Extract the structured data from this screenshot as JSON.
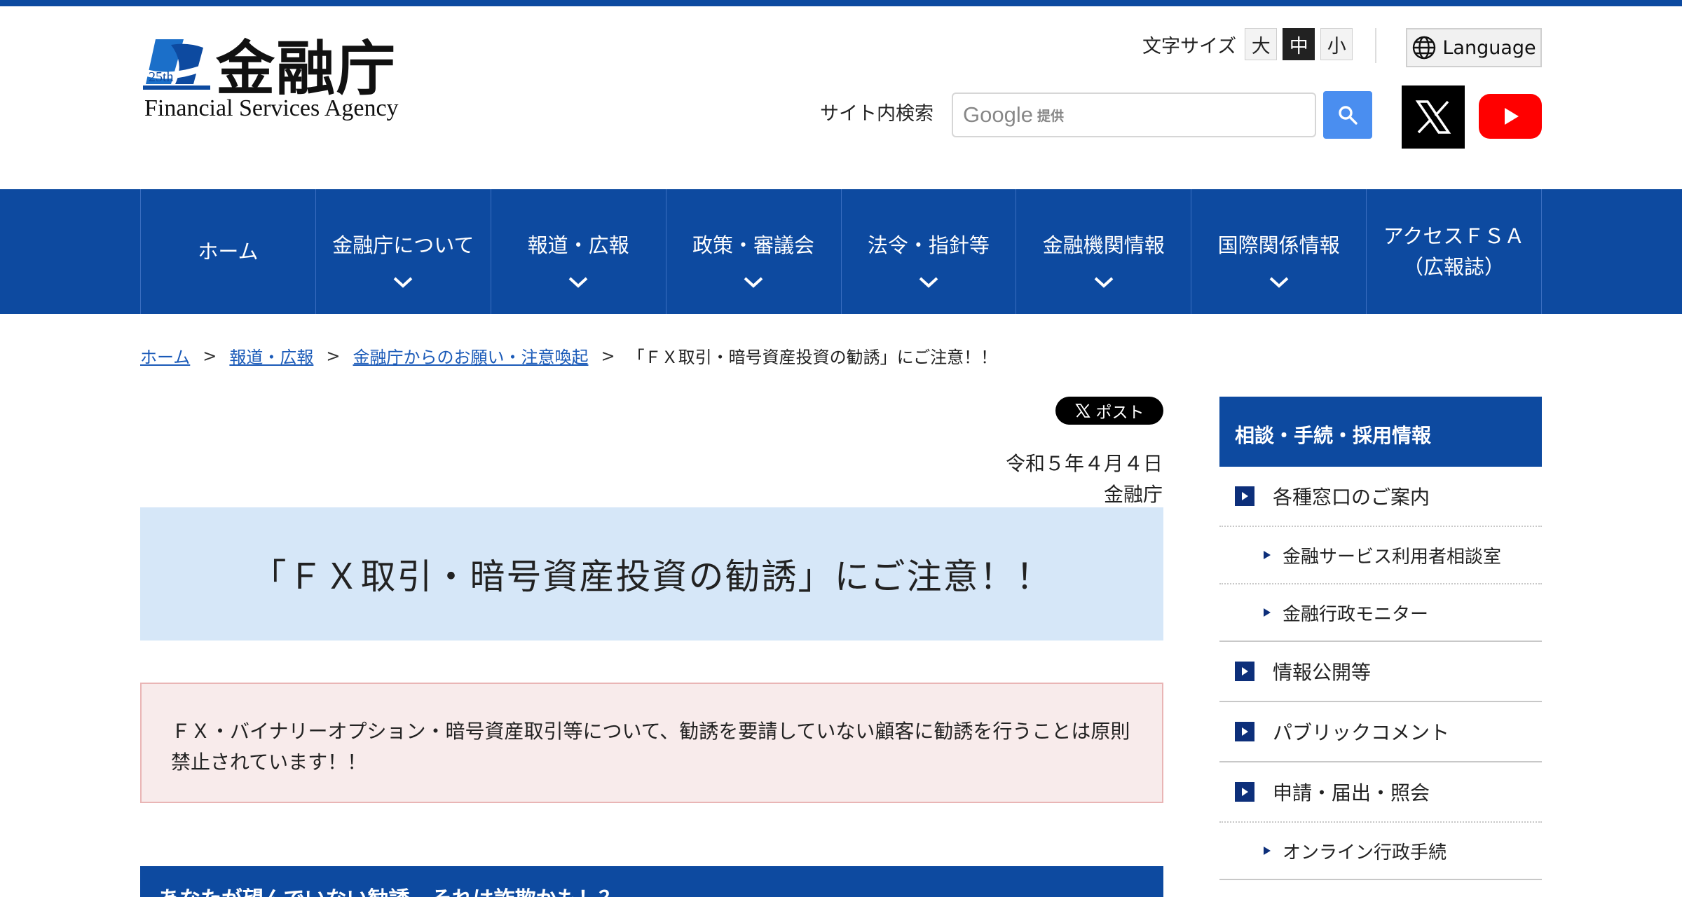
{
  "header": {
    "logo_ja": "金融庁",
    "logo_en": "Financial Services Agency",
    "logo_badge": "25th",
    "font_size_label": "文字サイズ",
    "font_sizes": [
      "大",
      "中",
      "小"
    ],
    "active_font_size": "中",
    "language_label": "Language",
    "search_label": "サイト内検索",
    "search_brand": "Google",
    "search_brand_sub": "提供"
  },
  "nav": {
    "items": [
      {
        "label": "ホーム"
      },
      {
        "label": "金融庁について"
      },
      {
        "label": "報道・広報"
      },
      {
        "label": "政策・審議会"
      },
      {
        "label": "法令・指針等"
      },
      {
        "label": "金融機関情報"
      },
      {
        "label": "国際関係情報"
      },
      {
        "label": "アクセスＦＳＡ\n（広報誌）"
      }
    ]
  },
  "breadcrumb": {
    "items": [
      "ホーム",
      "報道・広報",
      "金融庁からのお願い・注意喚起"
    ],
    "current": "「ＦＸ取引・暗号資産投資の勧誘」にご注意！！",
    "separator": ">"
  },
  "main": {
    "post_label": "ポスト",
    "date": "令和５年４月４日",
    "agency": "金融庁",
    "title": "「ＦＸ取引・暗号資産投資の勧誘」にご注意！！",
    "notice": "ＦＸ・バイナリーオプション・暗号資産取引等について、勧誘を要請していない顧客に勧誘を行うことは原則禁止されています！！",
    "section_heading": "あなたが望んでいない勧誘、それは詐欺かも！？"
  },
  "sidebar": {
    "heading": "相談・手続・採用情報",
    "items": [
      {
        "label": "各種窓口のご案内",
        "level": 1
      },
      {
        "label": "金融サービス利用者相談室",
        "level": 2
      },
      {
        "label": "金融行政モニター",
        "level": 2
      },
      {
        "label": "情報公開等",
        "level": 1
      },
      {
        "label": "パブリックコメント",
        "level": 1
      },
      {
        "label": "申請・届出・照会",
        "level": 1
      },
      {
        "label": "オンライン行政手続",
        "level": 2
      }
    ]
  },
  "colors": {
    "brand_blue": "#0d4aa0",
    "title_bg": "#d6e7f8",
    "notice_bg": "#f8ebeb",
    "notice_border": "#e9b5b5",
    "search_button": "#4a8ef0",
    "youtube_red": "#ff0000"
  },
  "icons": {
    "language": "globe-icon",
    "search": "search-icon",
    "x": "x-logo-icon",
    "youtube": "youtube-play-icon",
    "nav_dropdown": "chevron-down-icon",
    "sidebar_primary": "square-arrow-icon",
    "sidebar_secondary": "triangle-bullet-icon"
  }
}
